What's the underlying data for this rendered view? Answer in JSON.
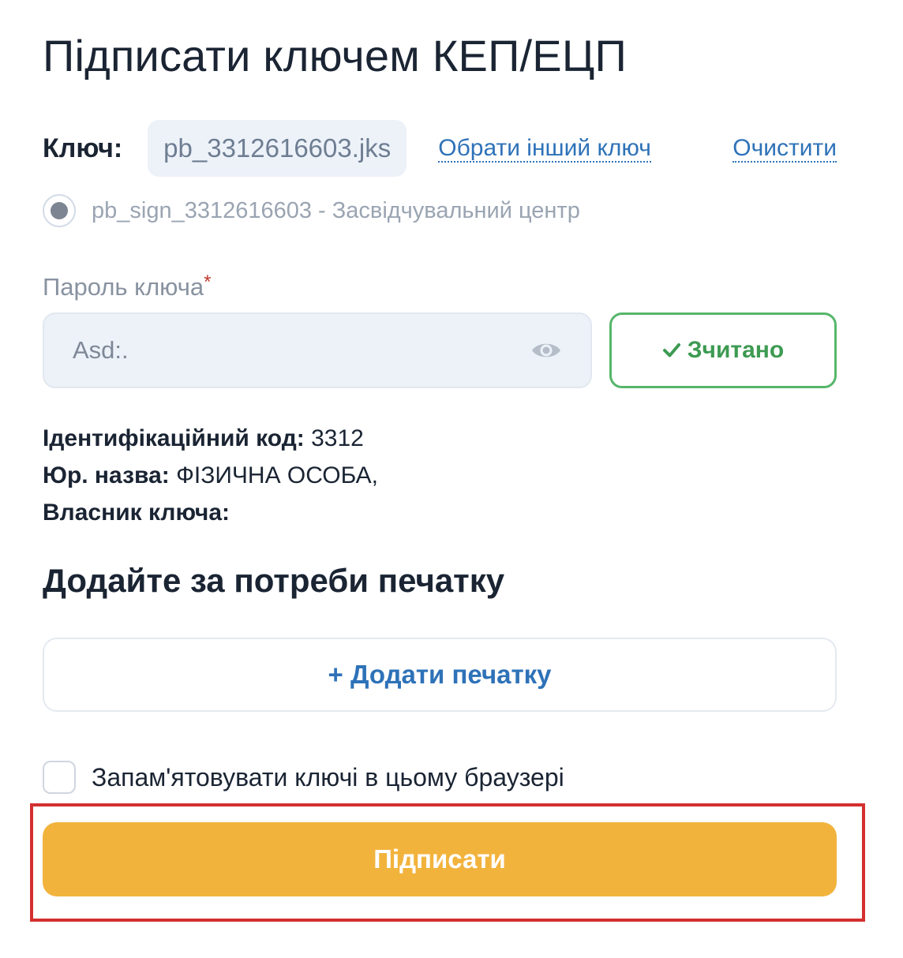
{
  "title": "Підписати ключем КЕП/ЕЦП",
  "key": {
    "label": "Ключ:",
    "file_name": "pb_3312616603.jks",
    "choose_other_link": "Обрати інший ключ",
    "clear_link": "Очистити"
  },
  "certificate_option": {
    "label": "pb_sign_3312616603 - Засвідчувальний центр",
    "selected": true
  },
  "password": {
    "label": "Пароль ключа",
    "required_mark": "*",
    "value": "Asd:."
  },
  "read_button": {
    "label": "Зчитано",
    "status_color": "#56b66a"
  },
  "key_info": {
    "id_code_label": "Ідентифікаційний код:",
    "id_code_value": "3312",
    "legal_name_label": "Юр. назва:",
    "legal_name_value": "ФІЗИЧНА ОСОБА,",
    "owner_label": "Власник ключа:",
    "owner_value": ""
  },
  "stamp_section": {
    "title": "Додайте за потреби печатку",
    "add_button": "+ Додати печатку"
  },
  "remember": {
    "label": "Запам'ятовувати ключі в цьому браузері",
    "checked": false
  },
  "sign_button": {
    "label": "Підписати",
    "color": "#f2b33d"
  },
  "colors": {
    "accent_link": "#2e72b8",
    "highlight_frame": "#d3302f"
  }
}
